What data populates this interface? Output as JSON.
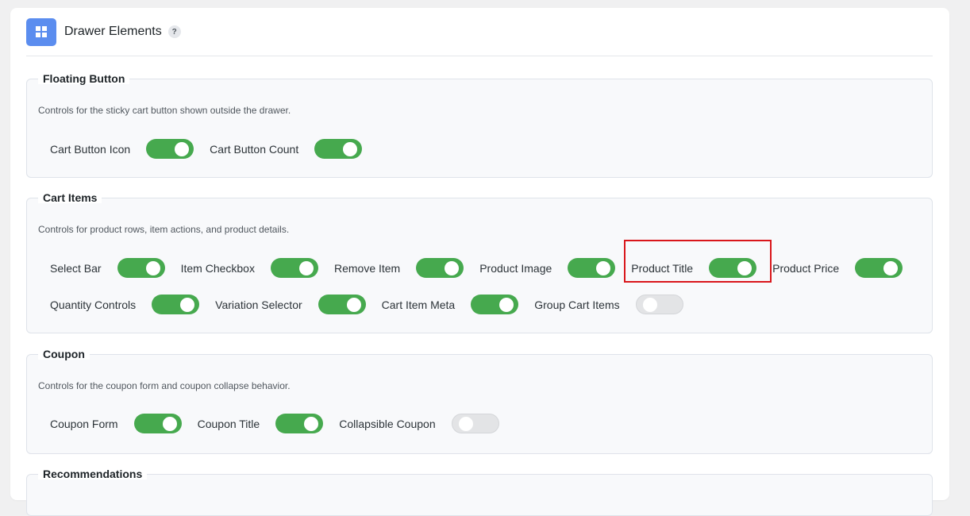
{
  "header": {
    "title": "Drawer Elements",
    "help": "?"
  },
  "sections": {
    "floating_button": {
      "title": "Floating Button",
      "description": "Controls for the sticky cart button shown outside the drawer.",
      "items": [
        {
          "label": "Cart Button Icon",
          "enabled": true
        },
        {
          "label": "Cart Button Count",
          "enabled": true
        }
      ]
    },
    "cart_items": {
      "title": "Cart Items",
      "description": "Controls for product rows, item actions, and product details.",
      "items": [
        {
          "label": "Select Bar",
          "enabled": true
        },
        {
          "label": "Item Checkbox",
          "enabled": true
        },
        {
          "label": "Remove Item",
          "enabled": true
        },
        {
          "label": "Product Image",
          "enabled": true
        },
        {
          "label": "Product Title",
          "enabled": true
        },
        {
          "label": "Product Price",
          "enabled": true
        },
        {
          "label": "Quantity Controls",
          "enabled": true
        },
        {
          "label": "Variation Selector",
          "enabled": true
        },
        {
          "label": "Cart Item Meta",
          "enabled": true
        },
        {
          "label": "Group Cart Items",
          "enabled": false
        }
      ]
    },
    "coupon": {
      "title": "Coupon",
      "description": "Controls for the coupon form and coupon collapse behavior.",
      "items": [
        {
          "label": "Coupon Form",
          "enabled": true
        },
        {
          "label": "Coupon Title",
          "enabled": true
        },
        {
          "label": "Collapsible Coupon",
          "enabled": false
        }
      ]
    },
    "recommendations": {
      "title": "Recommendations"
    }
  },
  "colors": {
    "toggle_on": "#46a94e",
    "toggle_off": "#e3e4e6",
    "accent": "#5b8def",
    "highlight": "#d9161b"
  }
}
